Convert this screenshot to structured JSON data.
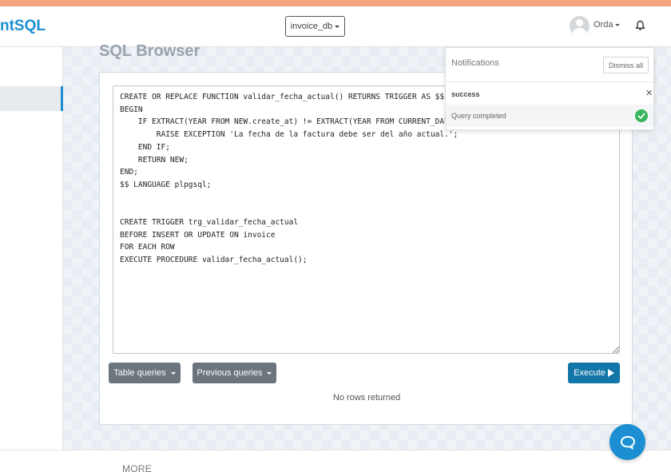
{
  "app": {
    "brand": "ntSQL"
  },
  "header": {
    "database": "invoice_db",
    "user": "Orda"
  },
  "page": {
    "title": "SQL Browser"
  },
  "editor": {
    "sql": "CREATE OR REPLACE FUNCTION validar_fecha_actual() RETURNS TRIGGER AS $$\nBEGIN\n    IF EXTRACT(YEAR FROM NEW.create_at) != EXTRACT(YEAR FROM CURRENT_DATE) THEN\n        RAISE EXCEPTION 'La fecha de la factura debe ser del año actual.';\n    END IF;\n    RETURN NEW;\nEND;\n$$ LANGUAGE plpgsql;\n\n\nCREATE TRIGGER trg_validar_fecha_actual\nBEFORE INSERT OR UPDATE ON invoice\nFOR EACH ROW\nEXECUTE PROCEDURE validar_fecha_actual();"
  },
  "buttons": {
    "table_queries": "Table queries",
    "previous_queries": "Previous queries",
    "execute": "Execute"
  },
  "result": {
    "message": "No rows returned"
  },
  "footer": {
    "more": "MORE"
  },
  "notifications": {
    "title": "Notifications",
    "dismiss_all": "Dismiss all",
    "items": [
      {
        "status": "success",
        "message": "Query completed"
      }
    ]
  },
  "colors": {
    "accent": "#1b8fd1",
    "execute": "#1277a8",
    "success": "#37b55a",
    "top_strip": "#f2a57e"
  }
}
